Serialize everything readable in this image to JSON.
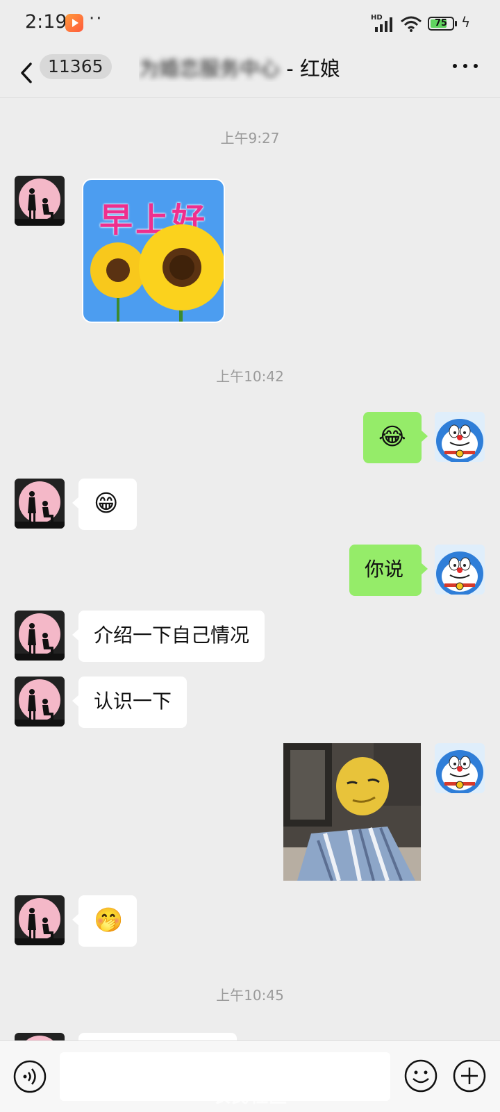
{
  "status_bar": {
    "time": "2:19",
    "dots": "··",
    "network_label": "HD",
    "battery_level": "75",
    "icons": [
      "video-app-icon",
      "signal-icon",
      "wifi-icon",
      "battery-icon",
      "charging-icon"
    ]
  },
  "header": {
    "back_icon": "chevron-left-icon",
    "unread_count": "11365",
    "title_blurred": "为婚恋服务中心",
    "title_visible": "红娘",
    "more_icon": "more-icon"
  },
  "timestamps": [
    "上午9:27",
    "上午10:42",
    "上午10:45"
  ],
  "messages": [
    {
      "side": "left",
      "type": "sticker",
      "sticker_text": "早上好"
    },
    {
      "side": "right",
      "type": "emoji",
      "emoji": "😂"
    },
    {
      "side": "left",
      "type": "emoji",
      "emoji": "😁"
    },
    {
      "side": "right",
      "type": "text",
      "text": "你说"
    },
    {
      "side": "left",
      "type": "text",
      "text": "介绍一下自己情况"
    },
    {
      "side": "left",
      "type": "text",
      "text": "认识一下"
    },
    {
      "side": "right",
      "type": "image"
    },
    {
      "side": "left",
      "type": "emoji",
      "emoji": "🤭"
    },
    {
      "side": "left",
      "type": "partial"
    }
  ],
  "input_bar": {
    "placeholder": "",
    "voice_icon": "voice-icon",
    "emoji_icon": "emoji-icon",
    "plus_icon": "plus-icon"
  },
  "watermark": "农民社区",
  "colors": {
    "background": "#ededed",
    "sent_bubble": "#95ec69",
    "received_bubble": "#ffffff",
    "timestamp": "#9a9a9a"
  }
}
